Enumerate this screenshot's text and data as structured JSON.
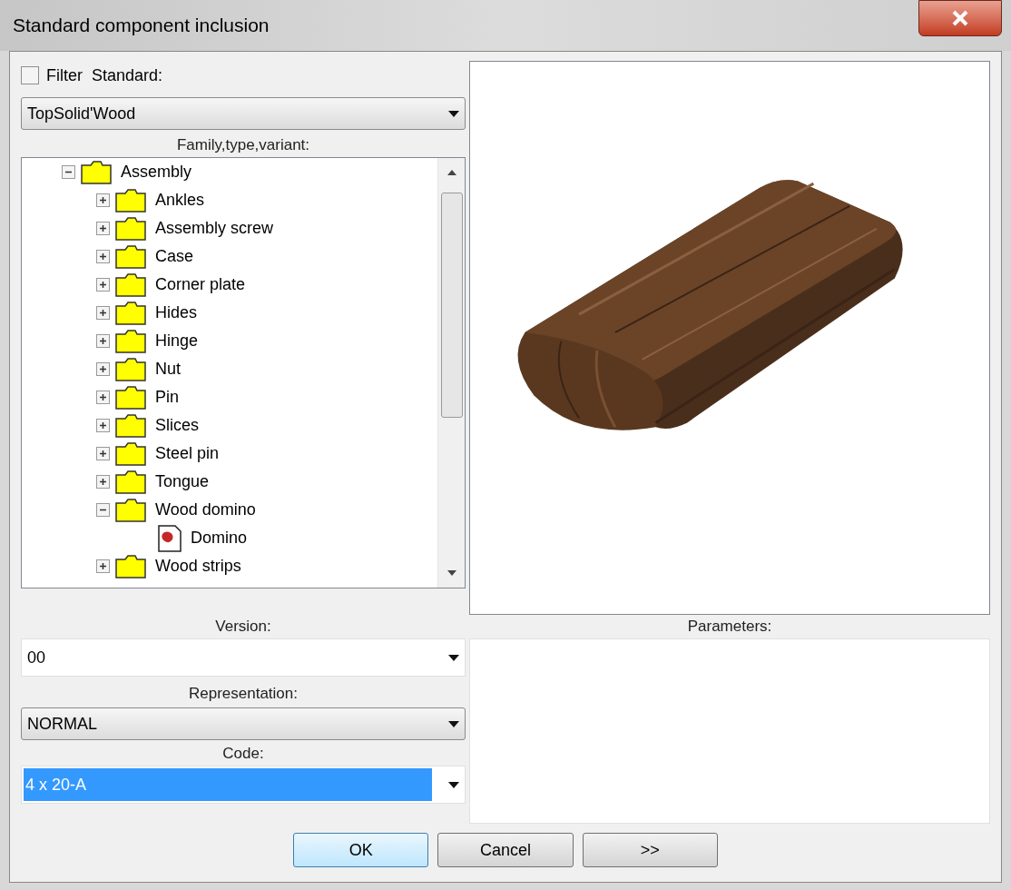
{
  "window": {
    "title": "Standard component inclusion"
  },
  "filter": {
    "label": "Filter  Standard:",
    "checked": false
  },
  "standard": {
    "value": "TopSolid'Wood"
  },
  "tree": {
    "label": "Family,type,variant:",
    "items": [
      {
        "label": "Assembly",
        "kind": "folder",
        "expanded": true,
        "children": [
          {
            "label": "Ankles",
            "kind": "folder",
            "expanded": false
          },
          {
            "label": "Assembly screw",
            "kind": "folder",
            "expanded": false
          },
          {
            "label": "Case",
            "kind": "folder",
            "expanded": false
          },
          {
            "label": "Corner plate",
            "kind": "folder",
            "expanded": false
          },
          {
            "label": "Hides",
            "kind": "folder",
            "expanded": false
          },
          {
            "label": "Hinge",
            "kind": "folder",
            "expanded": false
          },
          {
            "label": "Nut",
            "kind": "folder",
            "expanded": false
          },
          {
            "label": "Pin",
            "kind": "folder",
            "expanded": false
          },
          {
            "label": "Slices",
            "kind": "folder",
            "expanded": false
          },
          {
            "label": "Steel pin",
            "kind": "folder",
            "expanded": false
          },
          {
            "label": "Tongue",
            "kind": "folder",
            "expanded": false
          },
          {
            "label": "Wood domino",
            "kind": "folder",
            "expanded": true,
            "children": [
              {
                "label": "Domino",
                "kind": "part"
              }
            ]
          },
          {
            "label": "Wood strips",
            "kind": "folder",
            "expanded": false
          }
        ]
      }
    ]
  },
  "version": {
    "label": "Version:",
    "value": "00"
  },
  "representation": {
    "label": "Representation:",
    "value": "NORMAL"
  },
  "code": {
    "label": "Code:",
    "value": "4 x 20-A",
    "selected": true
  },
  "parameters": {
    "label": "Parameters:"
  },
  "buttons": [
    {
      "label": "OK",
      "kind": "default"
    },
    {
      "label": "Cancel",
      "kind": "normal"
    },
    {
      "label": ">>",
      "kind": "normal"
    }
  ]
}
